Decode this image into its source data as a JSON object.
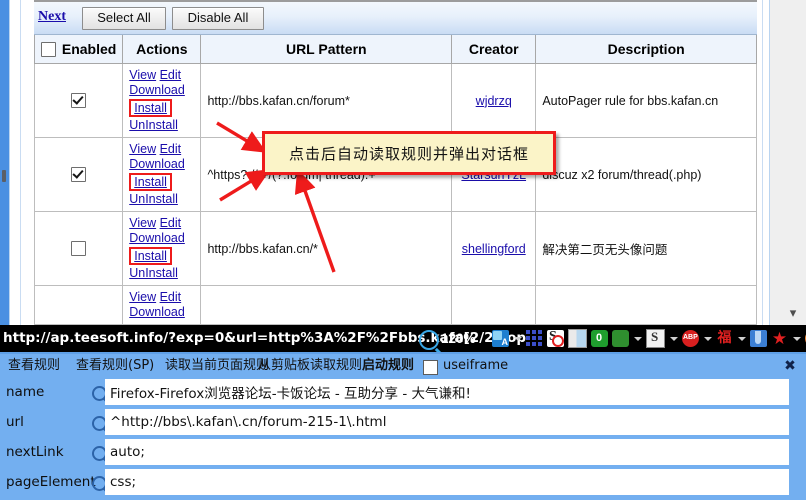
{
  "browser": {
    "toolbar": {
      "next_label": "Next",
      "select_all_label": "Select All",
      "disable_all_label": "Disable All"
    },
    "table": {
      "headers": {
        "enabled": "Enabled",
        "actions": "Actions",
        "url_pattern": "URL Pattern",
        "creator": "Creator",
        "description": "Description"
      },
      "header_checkbox_checked": false,
      "action_labels": {
        "view": "View",
        "edit": "Edit",
        "download": "Download",
        "install": "Install",
        "uninstall": "UnInstall"
      },
      "rows": [
        {
          "enabled": true,
          "url_pattern": "http://bbs.kafan.cn/forum*",
          "creator": "wjdrzq",
          "description": "AutoPager rule for bbs.kafan.cn"
        },
        {
          "enabled": true,
          "url_pattern": "^https?://.+/(?:forum| thread).+",
          "creator": "StarsunYzL",
          "description": "discuz x2 forum/thread(.php)"
        },
        {
          "enabled": false,
          "url_pattern": "http://bbs.kafan.cn/*",
          "creator": "shellingford",
          "description": "解决第二页无头像问题"
        },
        {
          "enabled": false,
          "url_pattern": "",
          "creator": "",
          "description": ""
        }
      ]
    },
    "annotation": {
      "text": "点击后自动读取规则并弹出对话框",
      "border_color": "#ee1b1b",
      "fill_color": "#fbf4c8"
    }
  },
  "statusbar": {
    "url": "http://ap.teesoft.info/?exp=0&url=http%3A%2F%2Fbbs.kafa",
    "page_indicator": "[2/2]Top",
    "zoom": "120%",
    "icons": [
      "language-input-icon",
      "caret-down-icon",
      "app-grid-icon",
      "noscript-icon",
      "reader-icon",
      "greenbrowser-counter-icon",
      "bug-icon",
      "caret-down-icon",
      "stylish-icon",
      "caret-down-icon",
      "adblock-plus-icon",
      "caret-down-icon",
      "fu-char-icon",
      "caret-down-icon",
      "flask-icon",
      "star-icon",
      "caret-down-icon",
      "firefox-icon"
    ]
  },
  "rule_panel": {
    "toolbar": {
      "view_rule": "查看规则",
      "view_rule_sp": "查看规则(SP)",
      "read_current_page_rule": "读取当前页面规则",
      "read_clipboard_rule": "从剪贴板读取规则",
      "start_rule": "启动规则",
      "useiframe_label": "useiframe",
      "useiframe_checked": false,
      "close_label": "✖"
    },
    "fields": [
      {
        "label": "name",
        "value": "Firefox-Firefox浏览器论坛-卡饭论坛 - 互助分享 - 大气谦和!"
      },
      {
        "label": "url",
        "value": "^http://bbs\\.kafan\\.cn/forum-215-1\\.html"
      },
      {
        "label": "nextLink",
        "value": "auto;"
      },
      {
        "label": "pageElement",
        "value": "css;"
      }
    ]
  }
}
